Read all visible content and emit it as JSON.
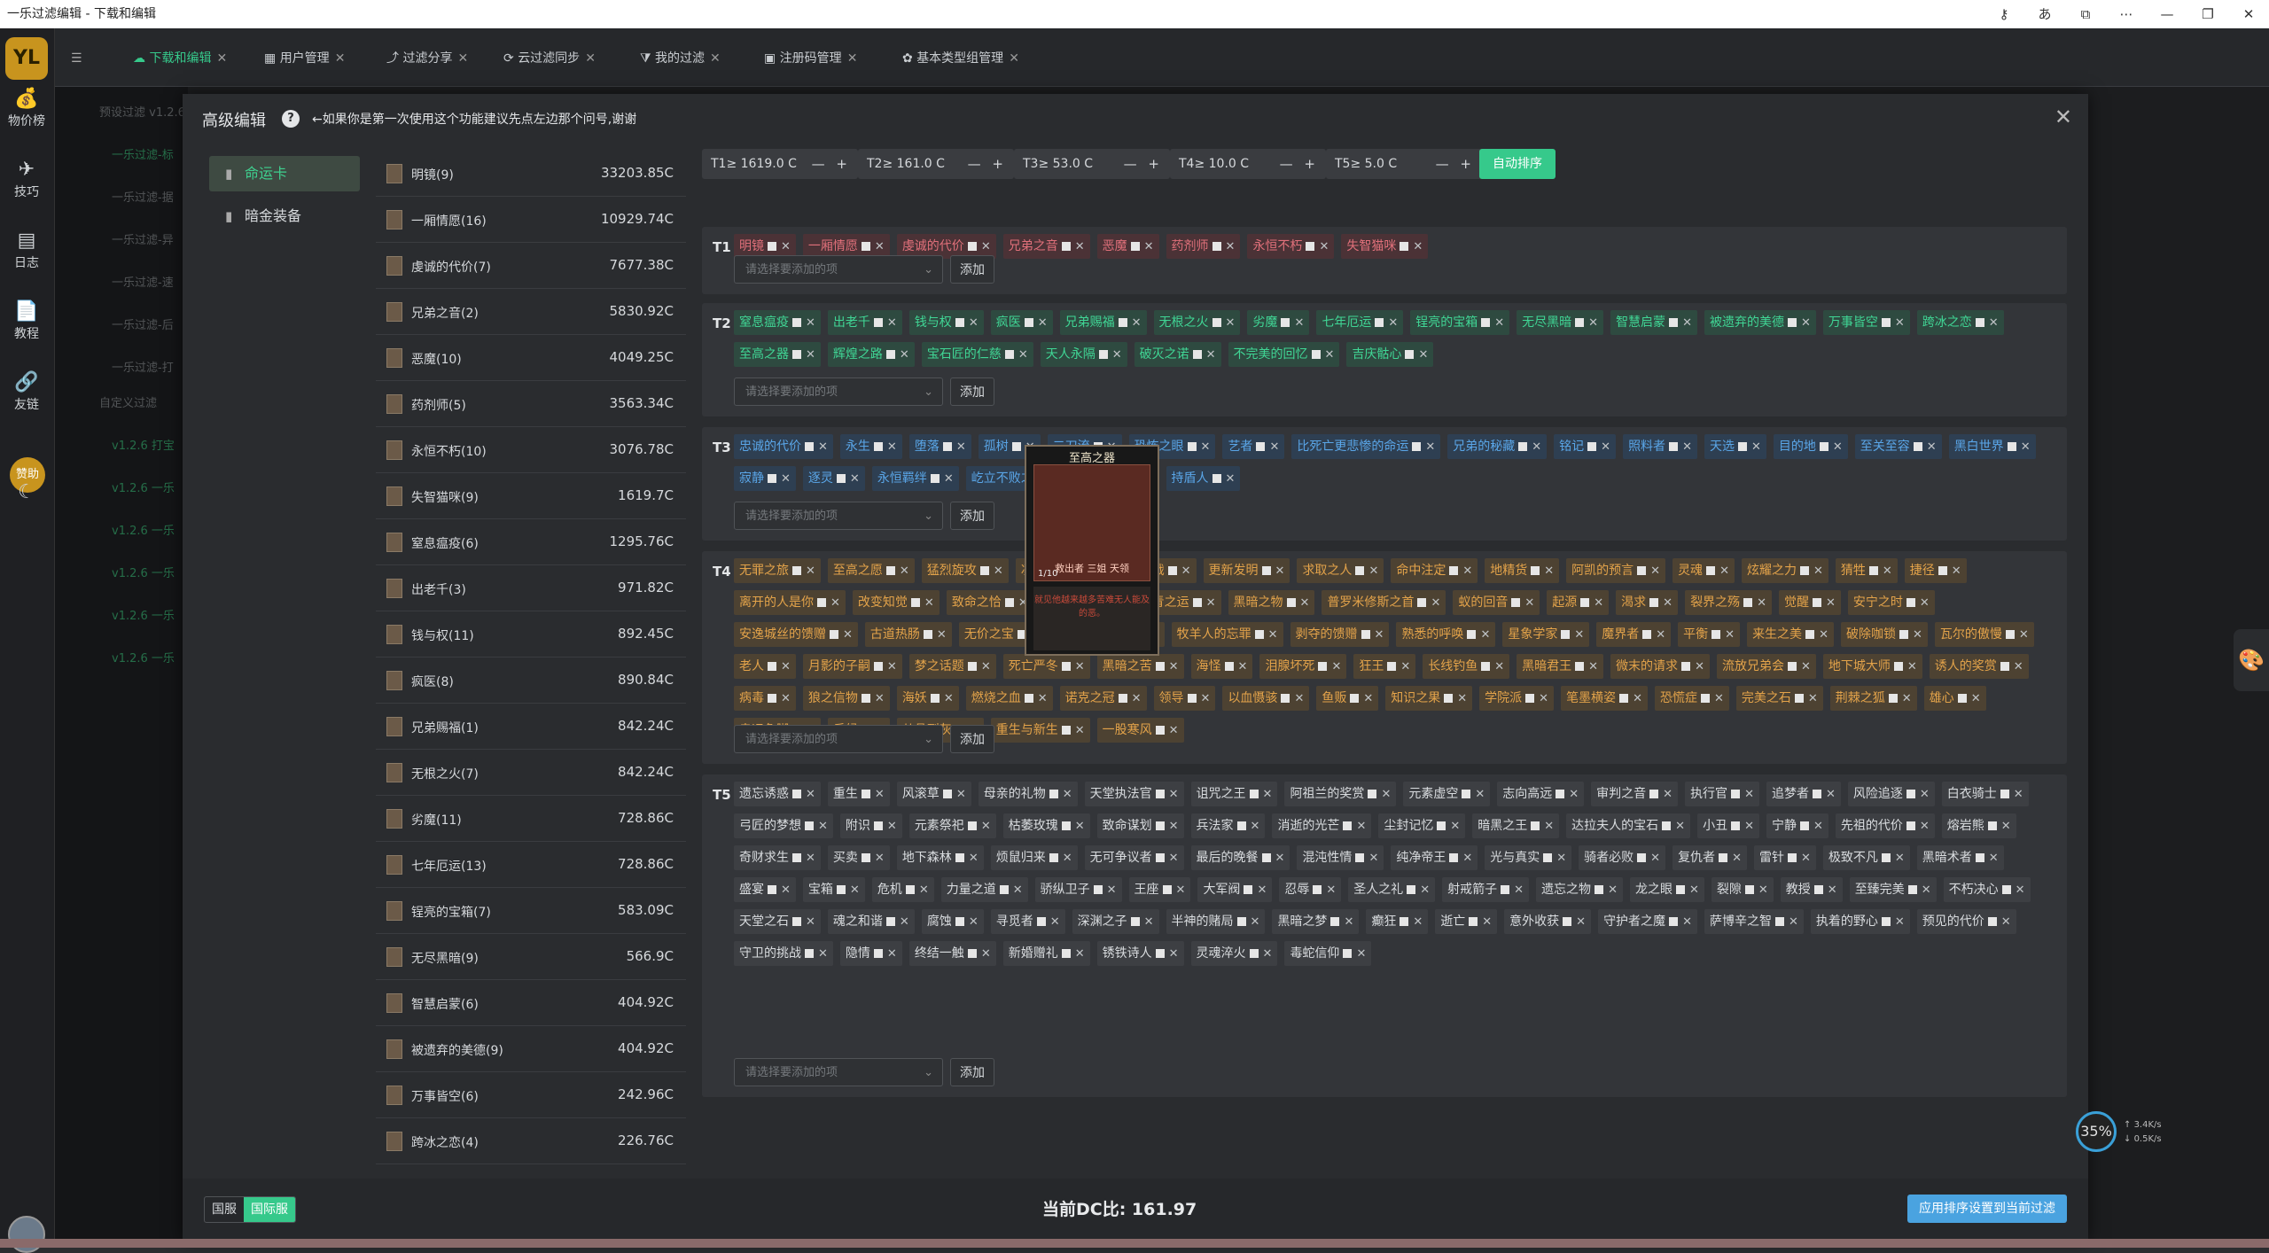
{
  "window": {
    "title": "一乐过滤编辑 - 下载和编辑"
  },
  "logo": "YL",
  "nav": [
    {
      "label": "物价榜",
      "icon": "money-bag-icon",
      "glyph": "💰"
    },
    {
      "label": "技巧",
      "icon": "plane-icon",
      "glyph": "✈"
    },
    {
      "label": "日志",
      "icon": "document-icon",
      "glyph": "▤"
    },
    {
      "label": "教程",
      "icon": "book-icon",
      "glyph": "📄"
    },
    {
      "label": "友链",
      "icon": "link-icon",
      "glyph": "🔗"
    }
  ],
  "sponsor": "赞助",
  "tabs": [
    {
      "label": "下载和编辑",
      "icon": "cloud-icon",
      "glyph": "☁",
      "active": true
    },
    {
      "label": "用户管理",
      "icon": "grid-icon",
      "glyph": "▦"
    },
    {
      "label": "过滤分享",
      "icon": "share-icon",
      "glyph": "⤴"
    },
    {
      "label": "云过滤同步",
      "icon": "sync-icon",
      "glyph": "⟳"
    },
    {
      "label": "我的过滤",
      "icon": "filter-icon",
      "glyph": "⧩"
    },
    {
      "label": "注册码管理",
      "icon": "clipboard-icon",
      "glyph": "▣"
    },
    {
      "label": "基本类型组管理",
      "icon": "shapes-icon",
      "glyph": "✿"
    }
  ],
  "bg_sidebar": [
    {
      "text": "预设过滤 v1.2.6",
      "green": false
    },
    {
      "text": "一乐过滤-标",
      "green": true
    },
    {
      "text": "一乐过滤-据",
      "green": false
    },
    {
      "text": "一乐过滤-异",
      "green": false
    },
    {
      "text": "一乐过滤-速",
      "green": false
    },
    {
      "text": "一乐过滤-后",
      "green": false
    },
    {
      "text": "一乐过滤-打",
      "green": false
    },
    {
      "text": "自定义过滤",
      "green": false
    },
    {
      "text": "v1.2.6 打宝",
      "green": true
    },
    {
      "text": "v1.2.6 一乐",
      "green": true
    },
    {
      "text": "v1.2.6 一乐",
      "green": true
    },
    {
      "text": "v1.2.6 一乐",
      "green": true
    },
    {
      "text": "v1.2.6 一乐",
      "green": true
    },
    {
      "text": "v1.2.6 一乐",
      "green": true
    }
  ],
  "modal": {
    "title": "高级编辑",
    "hint": "←如果你是第一次使用这个功能建议先点左边那个问号,谢谢",
    "close": "✕"
  },
  "categories": [
    {
      "label": "命运卡",
      "active": true
    },
    {
      "label": "暗金装备",
      "active": false
    }
  ],
  "cards": [
    {
      "name": "明镜(9)",
      "value": "33203.85C"
    },
    {
      "name": "一厢情愿(16)",
      "value": "10929.74C"
    },
    {
      "name": "虔诚的代价(7)",
      "value": "7677.38C"
    },
    {
      "name": "兄弟之音(2)",
      "value": "5830.92C"
    },
    {
      "name": "恶魔(10)",
      "value": "4049.25C"
    },
    {
      "name": "药剂师(5)",
      "value": "3563.34C"
    },
    {
      "name": "永恒不朽(10)",
      "value": "3076.78C"
    },
    {
      "name": "失智猫咪(9)",
      "value": "1619.7C"
    },
    {
      "name": "窒息瘟疫(6)",
      "value": "1295.76C"
    },
    {
      "name": "出老千(3)",
      "value": "971.82C"
    },
    {
      "name": "钱与权(11)",
      "value": "892.45C"
    },
    {
      "name": "疯医(8)",
      "value": "890.84C"
    },
    {
      "name": "兄弟赐福(1)",
      "value": "842.24C"
    },
    {
      "name": "无根之火(7)",
      "value": "842.24C"
    },
    {
      "name": "劣魔(11)",
      "value": "728.86C"
    },
    {
      "name": "七年厄运(13)",
      "value": "728.86C"
    },
    {
      "name": "锃亮的宝箱(7)",
      "value": "583.09C"
    },
    {
      "name": "无尽黑暗(9)",
      "value": "566.9C"
    },
    {
      "name": "智慧启蒙(6)",
      "value": "404.92C"
    },
    {
      "name": "被遗弃的美德(9)",
      "value": "404.92C"
    },
    {
      "name": "万事皆空(6)",
      "value": "242.96C"
    },
    {
      "name": "跨冰之恋(4)",
      "value": "226.76C"
    }
  ],
  "thresholds": [
    {
      "text": "T1≥ 1619.0  C"
    },
    {
      "text": "T2≥ 161.0  C"
    },
    {
      "text": "T3≥ 53.0  C"
    },
    {
      "text": "T4≥ 10.0  C"
    },
    {
      "text": "T5≥ 5.0  C"
    }
  ],
  "spinner": "— +",
  "auto_sort": "自动排序",
  "select_placeholder": "请选择要添加的项",
  "add_label": "添加",
  "tiers": [
    {
      "label": "T1",
      "tags": [
        "明镜",
        "一厢情愿",
        "虔诚的代价",
        "兄弟之音",
        "恶魔",
        "药剂师",
        "永恒不朽",
        "失智猫咪"
      ]
    },
    {
      "label": "T2",
      "tags": [
        "窒息瘟疫",
        "出老千",
        "钱与权",
        "疯医",
        "兄弟赐福",
        "无根之火",
        "劣魔",
        "七年厄运",
        "锃亮的宝箱",
        "无尽黑暗",
        "智慧启蒙",
        "被遗弃的美德",
        "万事皆空",
        "跨冰之恋",
        "至高之器",
        "辉煌之路",
        "宝石匠的仁慈",
        "天人永隔",
        "破灭之诺",
        "不完美的回忆",
        "吉庆骷心"
      ]
    },
    {
      "label": "T3",
      "tags": [
        "忠诚的代价",
        "永生",
        "堕落",
        "孤树",
        "二刀流",
        "恐怖之眼",
        "艺者",
        "比死亡更悲惨的命运",
        "兄弟的秘藏",
        "铭记",
        "照料者",
        "天选",
        "目的地",
        "至关至容",
        "黑白世界",
        "寂静",
        "逐灵",
        "永恒羁绊",
        "屹立不败之人",
        "代表作",
        "持盾人"
      ]
    },
    {
      "label": "T4",
      "tags": [
        "无罪之旅",
        "至高之愿",
        "猛烈旋攻",
        "凛冬之拥",
        "永恒之战",
        "更新发明",
        "求取之人",
        "命中注定",
        "地精货",
        "阿凯的预言",
        "灵魂",
        "炫耀之力",
        "猜牲",
        "捷径",
        "离开的人是你",
        "改变知觉",
        "致命之恰",
        "黑暗半面",
        "垂青之运",
        "黑暗之物",
        "普罗米修斯之首",
        "蚁的回音",
        "起源",
        "渴求",
        "裂界之殇",
        "觉醒",
        "安宁之时",
        "安逸城丝的馈赠",
        "古道热肠",
        "无价之宝",
        "被遗忘的宝藏",
        "牧羊人的忘罪",
        "剥夺的馈赠",
        "熟悉的呼唤",
        "星象学家",
        "魔界者",
        "平衡",
        "来生之美",
        "破除咖锁",
        "瓦尔的傲慢",
        "老人",
        "月影的子嗣",
        "梦之话题",
        "死亡严冬",
        "黑暗之苦",
        "海怪",
        "泪腺坏死",
        "狂王",
        "长线钓鱼",
        "黑暗君王",
        "微末的请求",
        "流放兄弟会",
        "地下城大师",
        "诱人的奖赏",
        "病毒",
        "狼之信物",
        "海妖",
        "燃烧之血",
        "诺克之冠",
        "领导",
        "以血慑骇",
        "鱼贩",
        "知识之果",
        "学院派",
        "笔墨横姿",
        "恐慌症",
        "完美之石",
        "荆棘之狐",
        "雄心",
        "幸运兔脚",
        "斥候",
        "从骨到灰",
        "重生与新生",
        "一股寒风"
      ]
    },
    {
      "label": "T5",
      "tags": [
        "遗忘诱惑",
        "重生",
        "风滚草",
        "母亲的礼物",
        "天堂执法官",
        "诅咒之王",
        "阿祖兰的奖赏",
        "元素虚空",
        "志向高远",
        "审判之音",
        "执行官",
        "追梦者",
        "风险追逐",
        "白衣骑士",
        "弓匠的梦想",
        "附识",
        "元素祭祀",
        "枯萎玫瑰",
        "致命谋划",
        "兵法家",
        "消逝的光芒",
        "尘封记忆",
        "暗黑之王",
        "达拉夫人的宝石",
        "小丑",
        "宁静",
        "先祖的代价",
        "熔岩熊",
        "奇财求生",
        "买卖",
        "地下森林",
        "烦鼠归来",
        "无可争议者",
        "最后的晚餐",
        "混沌性情",
        "纯净帝王",
        "光与真实",
        "骑者必败",
        "复仇者",
        "雷针",
        "极致不凡",
        "黑暗术者",
        "盛宴",
        "宝箱",
        "危机",
        "力量之道",
        "骄纵卫子",
        "王座",
        "大军阀",
        "忍辱",
        "圣人之礼",
        "射戒箭子",
        "遗忘之物",
        "龙之眼",
        "裂隙",
        "教授",
        "至臻完美",
        "不朽决心",
        "天堂之石",
        "魂之和谐",
        "腐蚀",
        "寻觅者",
        "深渊之子",
        "半神的赌局",
        "黑暗之梦",
        "癫狂",
        "逝亡",
        "意外收获",
        "守护者之魔",
        "萨博辛之智",
        "执着的野心",
        "预见的代价",
        "守卫的挑战",
        "隐情",
        "终结一触",
        "新婚赠礼",
        "锈铁诗人",
        "灵魂淬火",
        "毒蛇信仰"
      ]
    }
  ],
  "preview": {
    "title": "至高之器",
    "count": "1/10",
    "flavor": "救出者 三姐 天领",
    "desc": "就见他越来越多苦难无人能及的恶。"
  },
  "footer": {
    "server_cn": "国服",
    "server_intl": "国际服",
    "ratio": "当前DC比: 161.97",
    "apply": "应用排序设置到当前过滤"
  },
  "speed": {
    "percent": "35%",
    "up": "3.4K/s",
    "down": "0.5K/s"
  }
}
